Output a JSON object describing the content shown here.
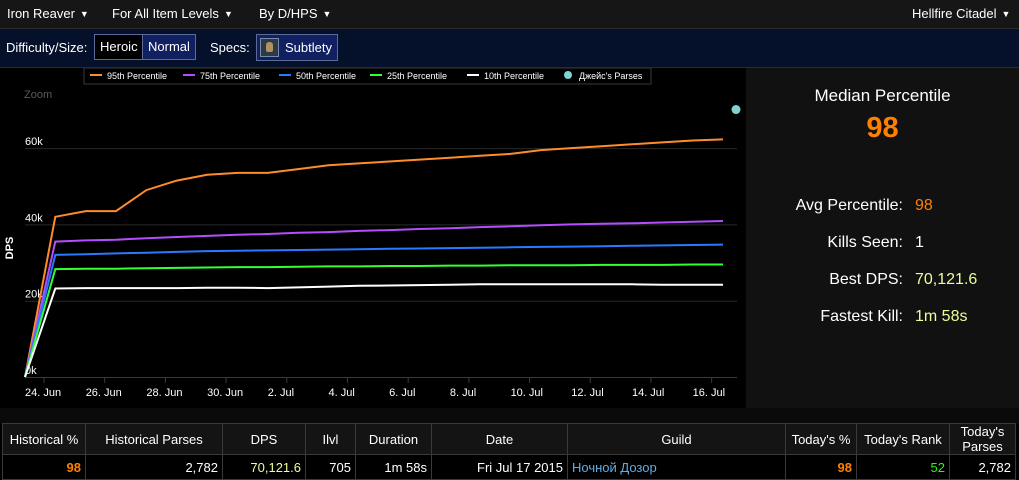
{
  "topbar": {
    "boss": "Iron Reaver",
    "item_levels": "For All Item Levels",
    "metric": "By D/HPS",
    "zone": "Hellfire Citadel"
  },
  "filters": {
    "difficulty_label": "Difficulty/Size:",
    "difficulty_options": [
      "Heroic",
      "Normal"
    ],
    "difficulty_selected": "Heroic",
    "specs_label": "Specs:",
    "spec": "Subtlety"
  },
  "summary": {
    "median_title": "Median Percentile",
    "median_value": "98",
    "stats": [
      {
        "label": "Avg Percentile:",
        "value": "98",
        "color": "#ff8000"
      },
      {
        "label": "Kills Seen:",
        "value": "1",
        "color": "#ffffff"
      },
      {
        "label": "Best DPS:",
        "value": "70,121.6",
        "color": "#e8ff9a"
      },
      {
        "label": "Fastest Kill:",
        "value": "1m 58s",
        "color": "#e8ff9a"
      }
    ]
  },
  "chart_data": {
    "type": "line",
    "zoom_label": "Zoom",
    "ylabel": "DPS",
    "ylim": [
      0,
      70000
    ],
    "yticks": [
      0,
      20000,
      40000,
      60000
    ],
    "ytick_labels": [
      "0k",
      "20k",
      "40k",
      "60k"
    ],
    "x_start": "2015-06-24",
    "x_end": "2015-07-17",
    "xtick_labels": [
      "24. Jun",
      "26. Jun",
      "28. Jun",
      "30. Jun",
      "2. Jul",
      "4. Jul",
      "6. Jul",
      "8. Jul",
      "10. Jul",
      "12. Jul",
      "14. Jul",
      "16. Jul"
    ],
    "xticks": [
      "2015-06-24",
      "2015-06-26",
      "2015-06-28",
      "2015-06-30",
      "2015-07-02",
      "2015-07-04",
      "2015-07-06",
      "2015-07-08",
      "2015-07-10",
      "2015-07-12",
      "2015-07-14",
      "2015-07-16"
    ],
    "x": [
      "2015-06-24",
      "2015-06-25",
      "2015-06-26",
      "2015-06-27",
      "2015-06-28",
      "2015-06-29",
      "2015-06-30",
      "2015-07-01",
      "2015-07-02",
      "2015-07-03",
      "2015-07-04",
      "2015-07-05",
      "2015-07-06",
      "2015-07-07",
      "2015-07-08",
      "2015-07-09",
      "2015-07-10",
      "2015-07-11",
      "2015-07-12",
      "2015-07-13",
      "2015-07-14",
      "2015-07-15",
      "2015-07-16",
      "2015-07-17"
    ],
    "legend_position": "top",
    "series": [
      {
        "name": "95th Percentile",
        "color": "#ff8c2a",
        "values": [
          0,
          42000,
          43500,
          43500,
          49000,
          51500,
          53000,
          53500,
          53500,
          54500,
          55500,
          56000,
          56500,
          57000,
          57500,
          58000,
          58500,
          59500,
          60000,
          60500,
          61000,
          61500,
          62000,
          62300
        ]
      },
      {
        "name": "75th Percentile",
        "color": "#b44dff",
        "values": [
          0,
          35500,
          35800,
          36000,
          36400,
          36700,
          37000,
          37300,
          37500,
          37800,
          38000,
          38300,
          38500,
          38800,
          39000,
          39300,
          39500,
          39800,
          40000,
          40200,
          40300,
          40500,
          40700,
          40900
        ]
      },
      {
        "name": "50th Percentile",
        "color": "#2a7aff",
        "values": [
          0,
          32000,
          32200,
          32400,
          32600,
          32800,
          33000,
          33100,
          33200,
          33300,
          33400,
          33500,
          33600,
          33700,
          33800,
          33900,
          34000,
          34100,
          34200,
          34300,
          34400,
          34500,
          34600,
          34700
        ]
      },
      {
        "name": "25th Percentile",
        "color": "#33ff33",
        "values": [
          0,
          28300,
          28400,
          28400,
          28500,
          28600,
          28700,
          28800,
          28800,
          28900,
          29000,
          29000,
          29100,
          29100,
          29200,
          29200,
          29300,
          29300,
          29300,
          29400,
          29400,
          29400,
          29500,
          29500
        ]
      },
      {
        "name": "10th Percentile",
        "color": "#ffffff",
        "values": [
          0,
          23200,
          23300,
          23300,
          23300,
          23300,
          23400,
          23400,
          23300,
          23500,
          23700,
          23900,
          24000,
          24100,
          24200,
          24300,
          24300,
          24300,
          24300,
          24300,
          24300,
          24200,
          24200,
          24200
        ]
      },
      {
        "name": "Джейс's Parses",
        "color": "#7fd3d3",
        "type": "scatter",
        "x": [
          "2015-07-17"
        ],
        "values": [
          70121.6
        ]
      }
    ]
  },
  "table": {
    "headers": [
      "Historical %",
      "Historical Parses",
      "DPS",
      "Ilvl",
      "Duration",
      "Date",
      "Guild",
      "Today's %",
      "Today's Rank",
      "Today's Parses"
    ],
    "rows": [
      [
        "98",
        "2,782",
        "70,121.6",
        "705",
        "1m 58s",
        "Fri Jul 17 2015",
        "Ночной Дозор",
        "98",
        "52",
        "2,782"
      ]
    ]
  }
}
